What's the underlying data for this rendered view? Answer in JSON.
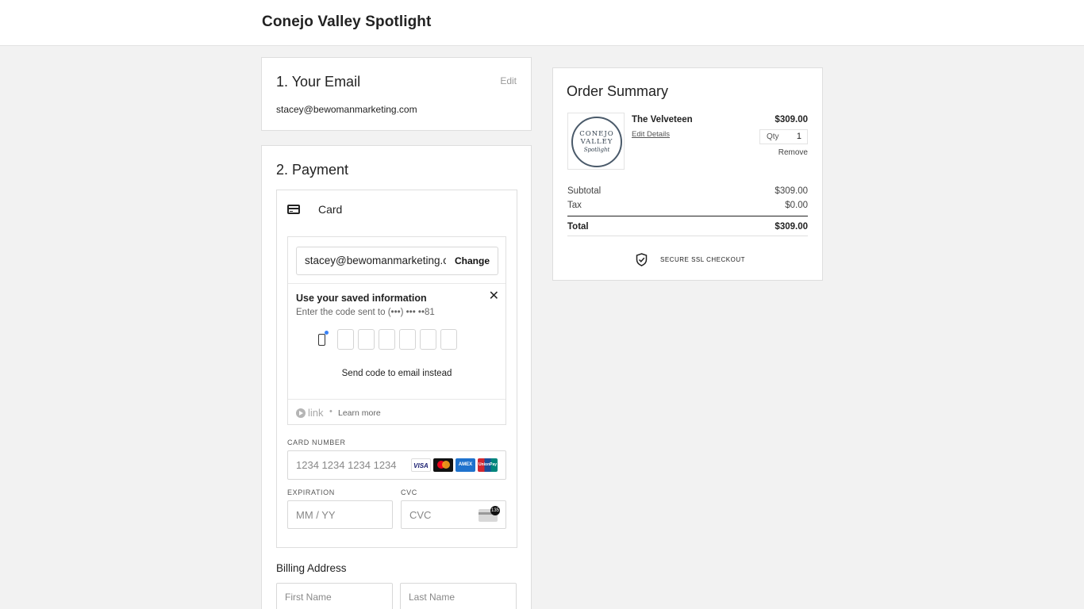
{
  "site": {
    "title": "Conejo Valley Spotlight"
  },
  "email_section": {
    "heading": "1.  Your Email",
    "edit_label": "Edit",
    "email": "stacey@bewomanmarketing.com"
  },
  "payment_section": {
    "heading": "2.  Payment",
    "method_label": "Card",
    "link": {
      "email": "stacey@bewomanmarketing.com",
      "change_label": "Change",
      "saved_title": "Use your saved information",
      "saved_subtitle": "Enter the code sent to (•••) ••• ••81",
      "send_email_label": "Send code to email instead",
      "brand": "link",
      "separator": "•",
      "learn_more": "Learn more"
    },
    "card_number": {
      "label": "CARD NUMBER",
      "placeholder": "1234 1234 1234 1234",
      "brands": [
        "VISA",
        "Mastercard",
        "AMEX",
        "UnionPay"
      ]
    },
    "expiration": {
      "label": "EXPIRATION",
      "placeholder": "MM / YY"
    },
    "cvc": {
      "label": "CVC",
      "placeholder": "CVC",
      "badge": "135"
    },
    "billing": {
      "title": "Billing Address",
      "first_name_placeholder": "First Name",
      "last_name_placeholder": "Last Name"
    }
  },
  "order_summary": {
    "heading": "Order Summary",
    "item": {
      "logo_line1": "CONEJO",
      "logo_line2": "VALLEY",
      "logo_line3": "Spotlight",
      "name": "The Velveteen",
      "edit_label": "Edit Details",
      "price": "$309.00",
      "qty_label": "Qty",
      "qty": "1",
      "remove_label": "Remove"
    },
    "subtotal_label": "Subtotal",
    "subtotal": "$309.00",
    "tax_label": "Tax",
    "tax": "$0.00",
    "total_label": "Total",
    "total": "$309.00",
    "ssl_label": "SECURE SSL CHECKOUT"
  }
}
